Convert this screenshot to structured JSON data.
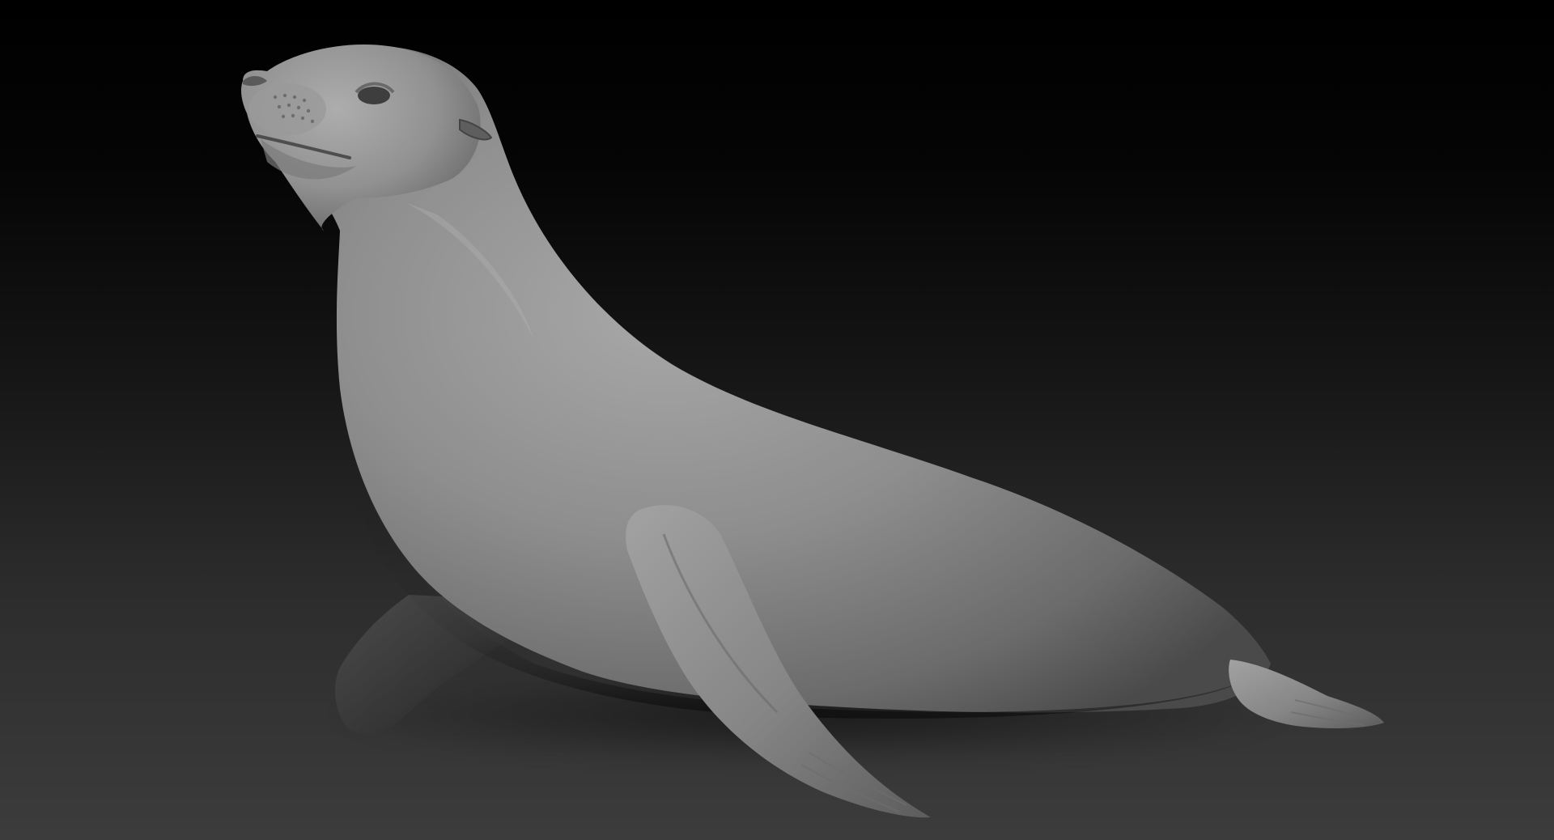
{
  "scene": {
    "subject": "sea-lion-sculpt",
    "colors": {
      "background_top": "#000000",
      "background_bottom": "#3c3c3c",
      "clay_light": "#a3a3a3",
      "clay_mid": "#7e7e7e",
      "clay_dark": "#3a3a3a",
      "shadow": "#141414"
    }
  }
}
